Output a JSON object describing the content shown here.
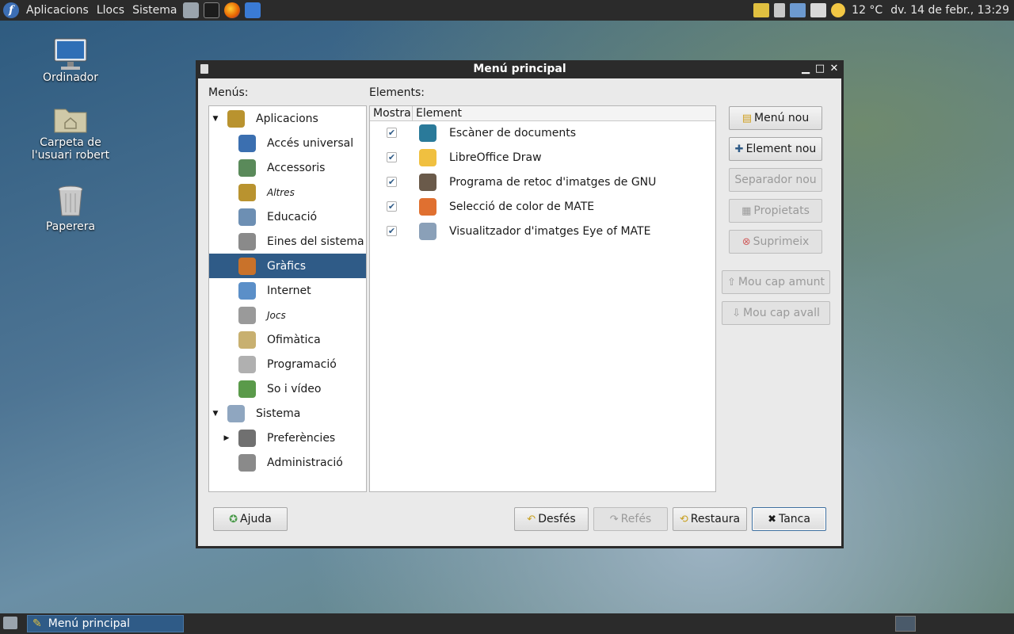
{
  "top_panel": {
    "menus": [
      "Aplicacions",
      "Llocs",
      "Sistema"
    ],
    "weather": "12 °C",
    "clock": "dv. 14 de febr., 13:29"
  },
  "desktop": {
    "icons": [
      "Ordinador",
      "Carpeta de l'usuari robert",
      "Paperera"
    ]
  },
  "window": {
    "title": "Menú principal",
    "menus_label": "Menús:",
    "elements_label": "Elements:",
    "tree": [
      {
        "label": "Aplicacions",
        "icon": "applications-icon",
        "level": 0,
        "expanded": true,
        "italic": false
      },
      {
        "label": "Accés universal",
        "icon": "accessibility-icon",
        "level": 1,
        "italic": false
      },
      {
        "label": "Accessoris",
        "icon": "accessories-icon",
        "level": 1,
        "italic": false
      },
      {
        "label": "Altres",
        "icon": "other-icon",
        "level": 1,
        "italic": true
      },
      {
        "label": "Educació",
        "icon": "education-icon",
        "level": 1,
        "italic": false
      },
      {
        "label": "Eines del sistema",
        "icon": "system-tools-icon",
        "level": 1,
        "italic": false
      },
      {
        "label": "Gràfics",
        "icon": "graphics-icon",
        "level": 1,
        "italic": false,
        "selected": true
      },
      {
        "label": "Internet",
        "icon": "internet-icon",
        "level": 1,
        "italic": false
      },
      {
        "label": "Jocs",
        "icon": "games-icon",
        "level": 1,
        "italic": true
      },
      {
        "label": "Ofimàtica",
        "icon": "office-icon",
        "level": 1,
        "italic": false
      },
      {
        "label": "Programació",
        "icon": "development-icon",
        "level": 1,
        "italic": false
      },
      {
        "label": "So i vídeo",
        "icon": "multimedia-icon",
        "level": 1,
        "italic": false
      },
      {
        "label": "Sistema",
        "icon": "system-icon",
        "level": 0,
        "expanded": true,
        "italic": false
      },
      {
        "label": "Preferències",
        "icon": "preferences-icon",
        "level": 1,
        "collapsed": true,
        "italic": false
      },
      {
        "label": "Administració",
        "icon": "administration-icon",
        "level": 1,
        "italic": false
      }
    ],
    "columns": [
      "Mostra",
      "Element"
    ],
    "items": [
      {
        "label": "Escàner de documents",
        "icon": "scanner-icon",
        "shown": true
      },
      {
        "label": "LibreOffice Draw",
        "icon": "libreoffice-draw-icon",
        "shown": true
      },
      {
        "label": "Programa de retoc d'imatges de GNU",
        "icon": "gimp-icon",
        "shown": true
      },
      {
        "label": "Selecció de color de MATE",
        "icon": "color-picker-icon",
        "shown": true
      },
      {
        "label": "Visualitzador d'imatges Eye of MATE",
        "icon": "image-viewer-icon",
        "shown": true
      }
    ],
    "side_buttons": {
      "new_menu": "Menú nou",
      "new_item": "Element nou",
      "new_separator": "Separador nou",
      "properties": "Propietats",
      "delete": "Suprimeix",
      "move_up": "Mou cap amunt",
      "move_down": "Mou cap avall"
    },
    "bottom_buttons": {
      "help": "Ajuda",
      "undo": "Desfés",
      "redo": "Refés",
      "revert": "Restaura",
      "close": "Tanca"
    }
  },
  "taskbar": {
    "active_window": "Menú principal"
  }
}
